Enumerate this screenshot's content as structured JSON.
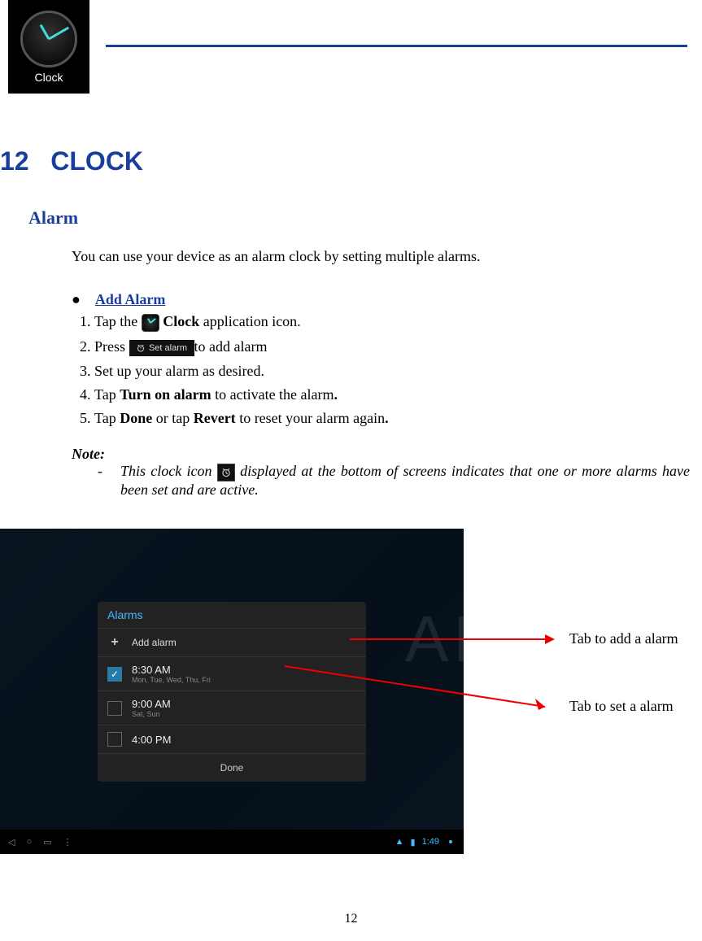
{
  "header": {
    "app_icon_label": "Clock"
  },
  "chapter": {
    "number": "12",
    "title": "CLOCK"
  },
  "section": {
    "title": "Alarm",
    "intro": "You can use your device as an alarm clock by setting multiple alarms."
  },
  "bullet": {
    "label": "Add Alarm"
  },
  "steps": {
    "s1_pre": "Tap the ",
    "s1_bold": "Clock",
    "s1_post": " application icon.",
    "s2_pre": "Press ",
    "s2_icon_text": "Set alarm",
    "s2_post": "to add alarm",
    "s3": "Set up your alarm as desired.",
    "s4_pre": "Tap ",
    "s4_bold": "Turn on alarm",
    "s4_post": " to activate the alarm",
    "s5_pre": "Tap ",
    "s5_bold1": "Done",
    "s5_mid": " or tap ",
    "s5_bold2": "Revert",
    "s5_post": " to reset your alarm again"
  },
  "note": {
    "label": "Note",
    "dash": "-",
    "text_pre": "This clock icon ",
    "text_post": " displayed at the bottom of screens indicates that one or more alarms have been set and are active."
  },
  "screenshot": {
    "panel_title": "Alarms",
    "add_label": "Add alarm",
    "alarms": [
      {
        "time": "8:30 AM",
        "days": "Mon, Tue, Wed, Thu, Fri",
        "on": true
      },
      {
        "time": "9:00 AM",
        "days": "Sat, Sun",
        "on": false
      },
      {
        "time": "4:00 PM",
        "days": "",
        "on": false
      }
    ],
    "done": "Done",
    "big_clock": "AM",
    "nav_time": "1:49",
    "nav_icons": {
      "back": "◁",
      "home": "○",
      "recent": "▭",
      "menu": "⋮"
    }
  },
  "callouts": {
    "c1": "Tab to add a alarm",
    "c2": "Tab to set a alarm"
  },
  "page_number": "12"
}
